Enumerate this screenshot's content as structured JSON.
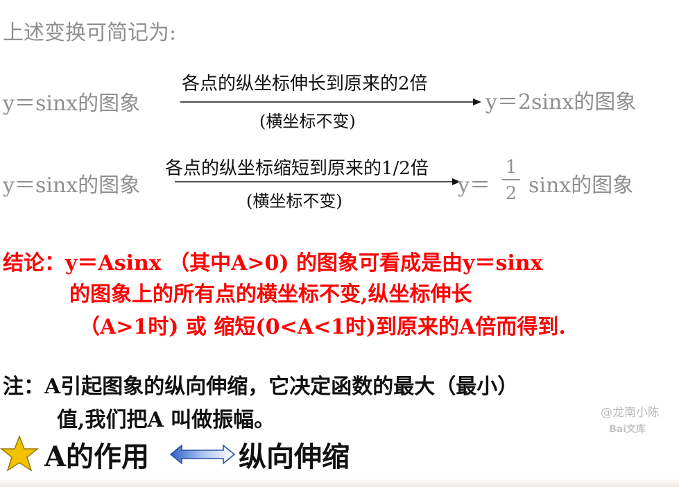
{
  "intro": "上述变换可简记为:",
  "transform1": {
    "from": "y＝sinx的图象",
    "above_arrow": "各点的纵坐标伸长到原来的2倍",
    "below_arrow": "(横坐标不变)",
    "to": "y＝2sinx的图象"
  },
  "transform2": {
    "from": "y＝sinx的图象",
    "above_arrow": "各点的纵坐标缩短到原来的1/2倍",
    "below_arrow": "(横坐标不变)",
    "to_prefix": "y＝",
    "frac_num": "1",
    "frac_den": "2",
    "to_suffix": "sinx的图象"
  },
  "conclusion": {
    "line1": "结论：y＝Asinx （其中A>0) 的图象可看成是由y＝sinx",
    "line2": "的图象上的所有点的横坐标不变,纵坐标伸长",
    "line3": "（A>1时) 或 缩短(0<A<1时)到原来的A倍而得到."
  },
  "note": {
    "line1": "注：A引起图象的纵向伸缩，它决定函数的最大（最小）",
    "line2": "值,我们把A 叫做振幅。"
  },
  "summary": {
    "left": "A的作用",
    "right": "纵向伸缩"
  },
  "watermark": {
    "author": "@龙南小陈",
    "brand": "Bai文库"
  },
  "colors": {
    "gray_text": "#8f8f8f",
    "conclusion_red": "#ff0000",
    "star_yellow": "#f2c200",
    "arrow_blue": "#4f7fd8"
  }
}
